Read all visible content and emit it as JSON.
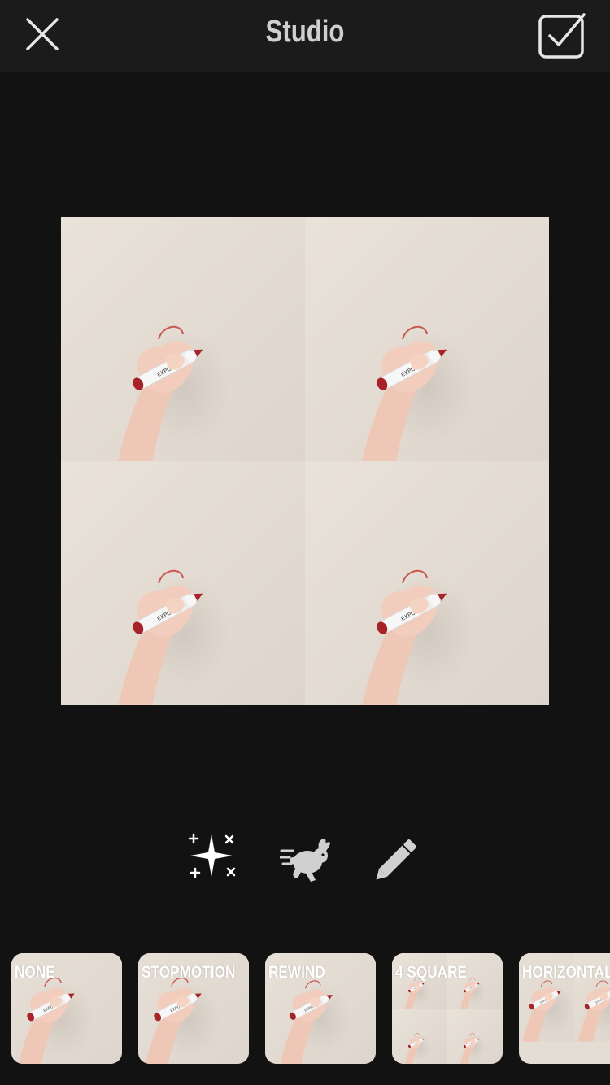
{
  "header": {
    "title": "Studio",
    "close_icon": "close-icon",
    "done_icon": "check-square-icon"
  },
  "tools": [
    {
      "icon": "sparkle-icon"
    },
    {
      "icon": "rabbit-icon"
    },
    {
      "icon": "pencil-icon"
    }
  ],
  "filters": [
    {
      "label": "NONE"
    },
    {
      "label": "STOPMOTION"
    },
    {
      "label": "REWIND"
    },
    {
      "label": "4 SQUARE"
    },
    {
      "label": "HORIZONTAL"
    }
  ],
  "colors": {
    "background": "#121212",
    "header": "#1b1b1b",
    "icon": "#d0d0d0",
    "wall": "#e4ddd4",
    "marker_cap": "#a8222a"
  }
}
